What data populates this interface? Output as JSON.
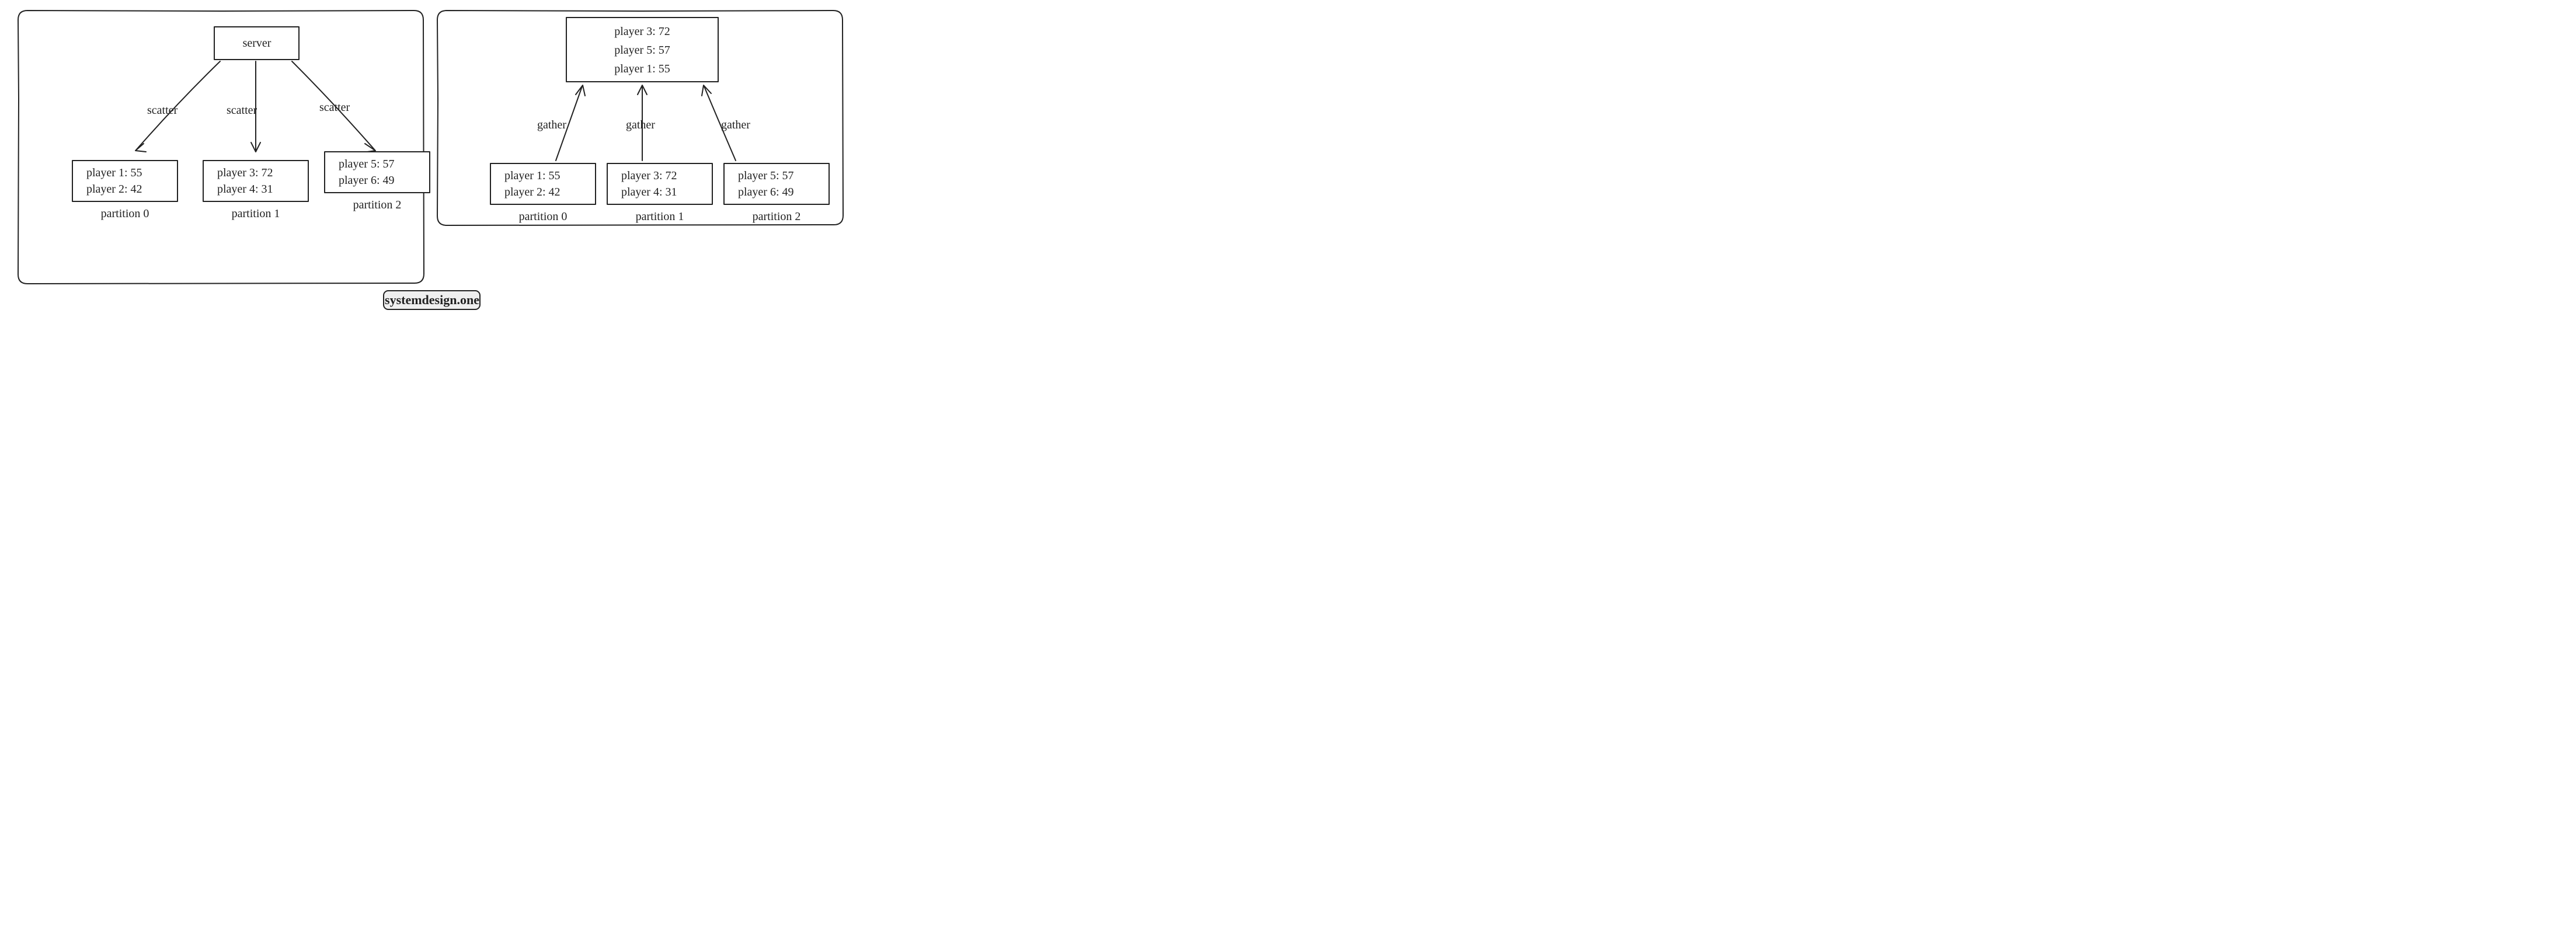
{
  "watermark": "systemdesign.one",
  "left": {
    "server_label": "server",
    "arrow_labels": {
      "a": "scatter",
      "b": "scatter",
      "c": "scatter"
    },
    "partitions": [
      {
        "caption": "partition 0",
        "rows": [
          "player 1: 55",
          "player 2: 42"
        ]
      },
      {
        "caption": "partition 1",
        "rows": [
          "player 3: 72",
          "player 4: 31"
        ]
      },
      {
        "caption": "partition 2",
        "rows": [
          "player 5: 57",
          "player 6: 49"
        ]
      }
    ]
  },
  "right": {
    "result_rows": [
      "player 3: 72",
      "player 5: 57",
      "player 1: 55"
    ],
    "arrow_labels": {
      "a": "gather",
      "b": "gather",
      "c": "gather"
    },
    "partitions": [
      {
        "caption": "partition 0",
        "rows": [
          "player 1: 55",
          "player 2: 42"
        ]
      },
      {
        "caption": "partition 1",
        "rows": [
          "player 3: 72",
          "player 4: 31"
        ]
      },
      {
        "caption": "partition 2",
        "rows": [
          "player 5: 57",
          "player 6: 49"
        ]
      }
    ]
  }
}
